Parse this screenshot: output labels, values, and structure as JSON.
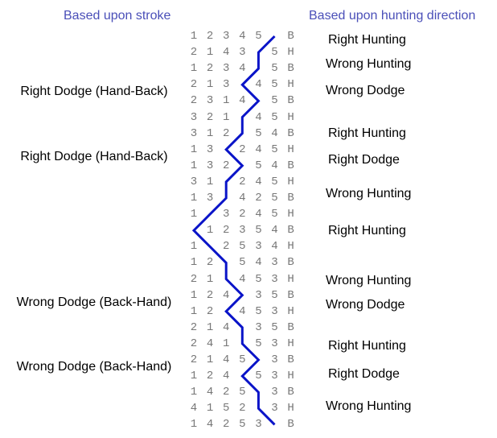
{
  "headers": {
    "left": "Based upon stroke",
    "right": "Based upon hunting direction"
  },
  "colors": {
    "header": "#4a4fb8",
    "path": "#0a14c8",
    "digits": "#777777"
  },
  "rows": [
    {
      "cells": [
        "1",
        "2",
        "3",
        "4",
        "5",
        "",
        "B"
      ],
      "blank": 5
    },
    {
      "cells": [
        "2",
        "1",
        "4",
        "3",
        "",
        "5",
        "H"
      ],
      "blank": 4
    },
    {
      "cells": [
        "1",
        "2",
        "3",
        "4",
        "",
        "5",
        "B"
      ],
      "blank": 4
    },
    {
      "cells": [
        "2",
        "1",
        "3",
        "",
        "4",
        "5",
        "H"
      ],
      "blank": 3
    },
    {
      "cells": [
        "2",
        "3",
        "1",
        "4",
        "",
        "5",
        "B"
      ],
      "blank": 4
    },
    {
      "cells": [
        "3",
        "2",
        "1",
        "",
        "4",
        "5",
        "H"
      ],
      "blank": 3
    },
    {
      "cells": [
        "3",
        "1",
        "2",
        "",
        "5",
        "4",
        "B"
      ],
      "blank": 3
    },
    {
      "cells": [
        "1",
        "3",
        "",
        "2",
        "4",
        "5",
        "H"
      ],
      "blank": 2
    },
    {
      "cells": [
        "1",
        "3",
        "2",
        "",
        "5",
        "4",
        "B"
      ],
      "blank": 3
    },
    {
      "cells": [
        "3",
        "1",
        "",
        "2",
        "4",
        "5",
        "H"
      ],
      "blank": 2
    },
    {
      "cells": [
        "1",
        "3",
        "",
        "4",
        "2",
        "5",
        "B"
      ],
      "blank": 2
    },
    {
      "cells": [
        "1",
        "",
        "3",
        "2",
        "4",
        "5",
        "H"
      ],
      "blank": 1
    },
    {
      "cells": [
        "",
        "1",
        "2",
        "3",
        "5",
        "4",
        "B"
      ],
      "blank": 0
    },
    {
      "cells": [
        "1",
        "",
        "2",
        "5",
        "3",
        "4",
        "H"
      ],
      "blank": 1
    },
    {
      "cells": [
        "1",
        "2",
        "",
        "5",
        "4",
        "3",
        "B"
      ],
      "blank": 2
    },
    {
      "cells": [
        "2",
        "1",
        "",
        "4",
        "5",
        "3",
        "H"
      ],
      "blank": 2
    },
    {
      "cells": [
        "1",
        "2",
        "4",
        "",
        "3",
        "5",
        "B"
      ],
      "blank": 3
    },
    {
      "cells": [
        "1",
        "2",
        "",
        "4",
        "5",
        "3",
        "H"
      ],
      "blank": 2
    },
    {
      "cells": [
        "2",
        "1",
        "4",
        "",
        "3",
        "5",
        "B"
      ],
      "blank": 3
    },
    {
      "cells": [
        "2",
        "4",
        "1",
        "",
        "5",
        "3",
        "H"
      ],
      "blank": 3
    },
    {
      "cells": [
        "2",
        "1",
        "4",
        "5",
        "",
        "3",
        "B"
      ],
      "blank": 4
    },
    {
      "cells": [
        "1",
        "2",
        "4",
        "",
        "5",
        "3",
        "H"
      ],
      "blank": 3
    },
    {
      "cells": [
        "1",
        "4",
        "2",
        "5",
        "",
        "3",
        "B"
      ],
      "blank": 4
    },
    {
      "cells": [
        "4",
        "1",
        "5",
        "2",
        "",
        "3",
        "H"
      ],
      "blank": 4
    },
    {
      "cells": [
        "1",
        "4",
        "2",
        "5",
        "3",
        "",
        "B"
      ],
      "blank": 5
    }
  ],
  "left_labels": [
    {
      "text": "Right Dodge (Hand-Back)",
      "row": 3.5
    },
    {
      "text": "Right Dodge (Hand-Back)",
      "row": 7.5
    },
    {
      "text": "Wrong Dodge (Back-Hand)",
      "row": 16.5
    },
    {
      "text": "Wrong Dodge (Back-Hand)",
      "row": 20.5
    }
  ],
  "right_labels": [
    {
      "text": "Right Hunting",
      "row": 0.25
    },
    {
      "text": "Wrong Hunting",
      "row": 1.75
    },
    {
      "text": "Wrong Dodge",
      "row": 3.4
    },
    {
      "text": "Right Hunting",
      "row": 6.0
    },
    {
      "text": "Right Dodge",
      "row": 7.65
    },
    {
      "text": "Wrong Hunting",
      "row": 9.75
    },
    {
      "text": "Right Hunting",
      "row": 12.05
    },
    {
      "text": "Wrong Hunting",
      "row": 15.1
    },
    {
      "text": "Wrong Dodge",
      "row": 16.6
    },
    {
      "text": "Right Hunting",
      "row": 19.15
    },
    {
      "text": "Right Dodge",
      "row": 20.9
    },
    {
      "text": "Wrong Hunting",
      "row": 22.9
    }
  ]
}
